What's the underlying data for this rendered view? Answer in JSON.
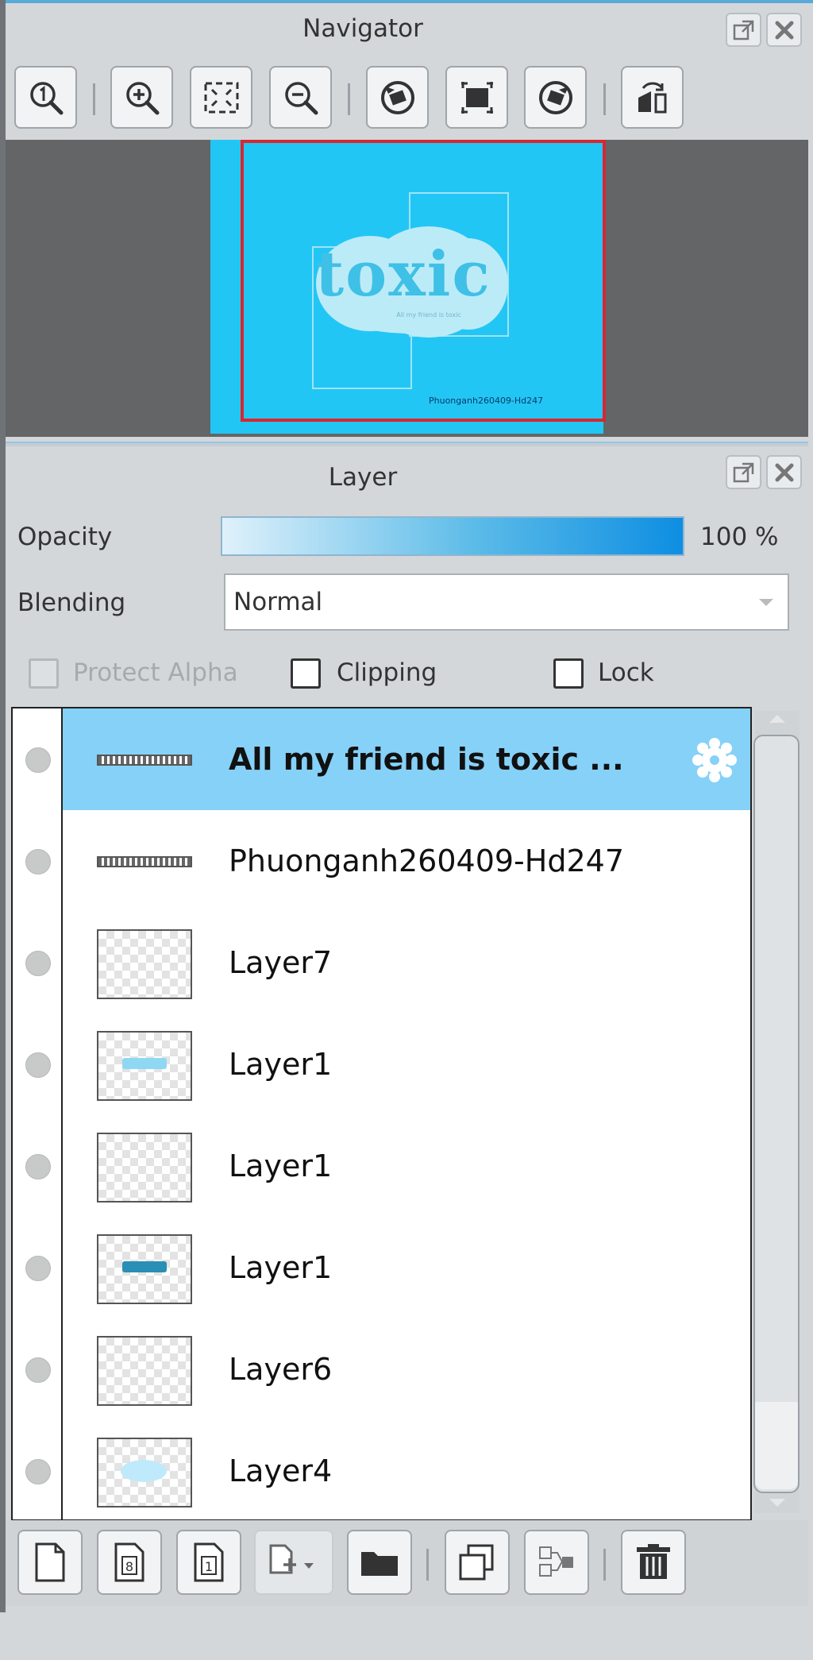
{
  "navigator": {
    "title": "Navigator",
    "toolbar": [
      {
        "name": "zoom-actual-button",
        "icon": "zoom-actual-icon"
      },
      {
        "name": "zoom-in-button",
        "icon": "zoom-in-icon"
      },
      {
        "name": "fit-screen-button",
        "icon": "fit-screen-icon"
      },
      {
        "name": "zoom-out-button",
        "icon": "zoom-out-icon"
      },
      {
        "name": "rotate-left-button",
        "icon": "rotate-left-icon"
      },
      {
        "name": "reset-view-button",
        "icon": "reset-view-icon"
      },
      {
        "name": "rotate-right-button",
        "icon": "rotate-right-icon"
      },
      {
        "name": "flip-horizontal-button",
        "icon": "flip-horizontal-icon"
      }
    ],
    "preview": {
      "logo_text": "toxic",
      "subtitle_text": "All my friend is toxic",
      "signature_text": "Phuonganh260409-Hd247",
      "canvas_color": "#22c6f5",
      "frame_color": "#d9262e"
    }
  },
  "layer_panel": {
    "title": "Layer",
    "opacity_label": "Opacity",
    "opacity_value": "100 %",
    "opacity_fraction": 1.0,
    "blending_label": "Blending",
    "blending_value": "Normal",
    "protect_alpha_label": "Protect Alpha",
    "clipping_label": "Clipping",
    "lock_label": "Lock",
    "layers": [
      {
        "name": "All my friend is toxic ...",
        "thumb": "text",
        "selected": true
      },
      {
        "name": "Phuonganh260409-Hd247",
        "thumb": "text",
        "selected": false
      },
      {
        "name": "Layer7",
        "thumb": "empty",
        "selected": false
      },
      {
        "name": "Layer1",
        "thumb": "logo-light",
        "selected": false
      },
      {
        "name": "Layer1",
        "thumb": "empty",
        "selected": false
      },
      {
        "name": "Layer1",
        "thumb": "logo-dark",
        "selected": false
      },
      {
        "name": "Layer6",
        "thumb": "empty",
        "selected": false
      },
      {
        "name": "Layer4",
        "thumb": "cloud",
        "selected": false
      }
    ],
    "bottom_toolbar": [
      "new-layer-icon",
      "new-8bit-layer-icon",
      "new-1bit-layer-icon",
      "add-layer-menu-icon",
      "new-folder-icon",
      "duplicate-layer-icon",
      "merge-down-icon",
      "delete-layer-icon"
    ],
    "selection_color": "#86d1f8"
  }
}
